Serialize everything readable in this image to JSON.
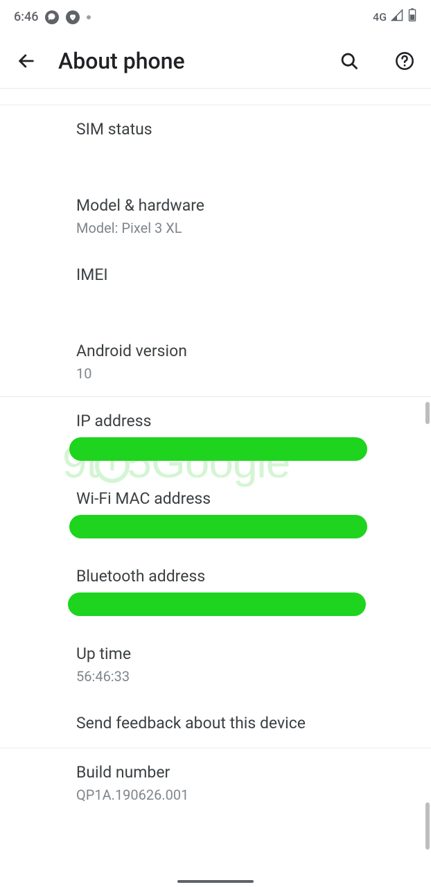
{
  "status_bar": {
    "time": "6:46",
    "network_label": "4G"
  },
  "header": {
    "title": "About phone"
  },
  "items": {
    "sim_status": {
      "title": "SIM status"
    },
    "model_hardware": {
      "title": "Model & hardware",
      "sub": "Model: Pixel 3 XL"
    },
    "imei": {
      "title": "IMEI"
    },
    "android_version": {
      "title": "Android version",
      "sub": "10"
    },
    "ip_address": {
      "title": "IP address"
    },
    "wifi_mac": {
      "title": "Wi-Fi MAC address"
    },
    "bluetooth_addr": {
      "title": "Bluetooth address"
    },
    "uptime": {
      "title": "Up time",
      "sub": "56:46:33"
    },
    "feedback": {
      "title": "Send feedback about this device"
    },
    "build_number": {
      "title": "Build number",
      "sub": "QP1A.190626.001"
    }
  },
  "watermark": "9to5Google"
}
